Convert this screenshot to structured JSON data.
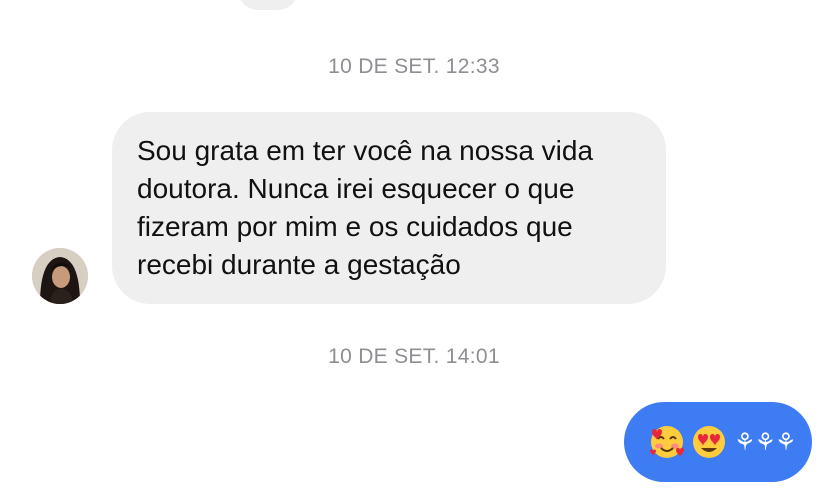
{
  "conversation": {
    "timestamps": [
      "10 DE SET. 12:33",
      "10 DE SET. 14:01"
    ],
    "incoming_message": {
      "lines": [
        "Sou grata em ter você na nossa vida",
        "doutora. Nunca irei esquecer o que",
        "fizeram por mim e os cuidados que",
        "recebi durante a gestação"
      ]
    },
    "outgoing_message": {
      "emojis": [
        "smiling-face-with-hearts",
        "heart-eyes"
      ],
      "flowers": "⚘⚘⚘"
    }
  },
  "colors": {
    "incoming_bubble": "#efefef",
    "outgoing_bubble": "#3d7cf2",
    "timestamp": "#8e8e93",
    "text": "#111111"
  }
}
